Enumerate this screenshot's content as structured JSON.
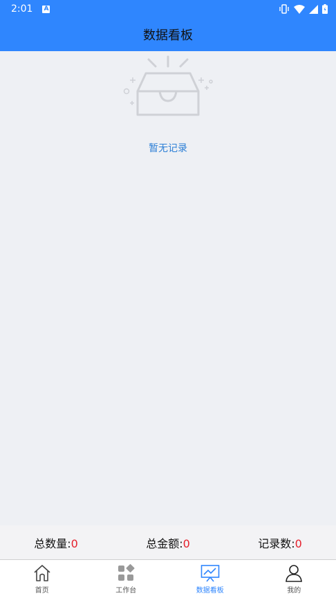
{
  "status": {
    "time": "2:01"
  },
  "header": {
    "title": "数据看板"
  },
  "empty": {
    "text": "暂无记录"
  },
  "summary": [
    {
      "label": "总数量:",
      "value": "0"
    },
    {
      "label": "总金额:",
      "value": "0"
    },
    {
      "label": "记录数:",
      "value": "0"
    }
  ],
  "tabs": [
    {
      "label": "首页",
      "icon": "home-icon"
    },
    {
      "label": "工作台",
      "icon": "grid-icon"
    },
    {
      "label": "数据看板",
      "icon": "chart-board-icon",
      "active": true
    },
    {
      "label": "我的",
      "icon": "user-icon"
    }
  ],
  "colors": {
    "primary": "#2f86fe",
    "value": "#e5202c",
    "empty_text": "#2d7fd6"
  }
}
